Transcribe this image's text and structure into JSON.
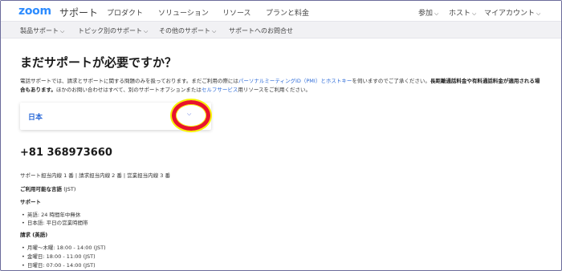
{
  "header": {
    "logo": "zoom",
    "logo_sub": "サポート",
    "nav_left": [
      "プロダクト",
      "ソリューション",
      "リソース",
      "プランと料金"
    ],
    "nav_right": [
      "参加",
      "ホスト",
      "マイアカウント"
    ]
  },
  "subnav": {
    "items": [
      "製品サポート",
      "トピック別のサポート",
      "その他のサポート",
      "サポートへのお問合せ"
    ]
  },
  "main": {
    "title": "まだサポートが必要ですか？",
    "intro_1": "電話サポートでは、請求とサポートに関する問題のみを扱っております。まだご利用の際には",
    "intro_link_1": "パーソナルミーティングID（PMI）とホストキー",
    "intro_2": "を伺いますのでご了承ください。",
    "intro_bold": "長距離通話料金や有料通話料金が適用される場合もあります。",
    "intro_3": "ほかのお問い合わせはすべて、別のサポートオプションまたは",
    "intro_link_2": "セルフサービス",
    "intro_4": "用リソースをご利用ください。",
    "country_selected": "日本",
    "phone": "+81 368973660",
    "extensions": "サポート担当内線 1 番 | 請求担当内線 2 番 | 営業担当内線 3 番",
    "languages_title": "ご利用可能な言語",
    "languages_tz": "(JST)",
    "support_title": "サポート",
    "support_items": [
      "英語: 24 時間年中無休",
      "日本語: 平日の営業時間帯"
    ],
    "billing_title": "請求 (英語)",
    "billing_items": [
      "月曜～木曜: 18:00 - 14:00 (JST)",
      "金曜日: 18:00 - 11:00 (JST)",
      "日曜日: 07:00 - 14:00 (JST)"
    ]
  },
  "colors": {
    "brand": "#2d8cff",
    "link": "#2d6bd8",
    "highlight_ring": "#e8132c",
    "highlight_glow": "#f7f200"
  },
  "icons": {
    "chevron": "chevron-down-icon"
  }
}
